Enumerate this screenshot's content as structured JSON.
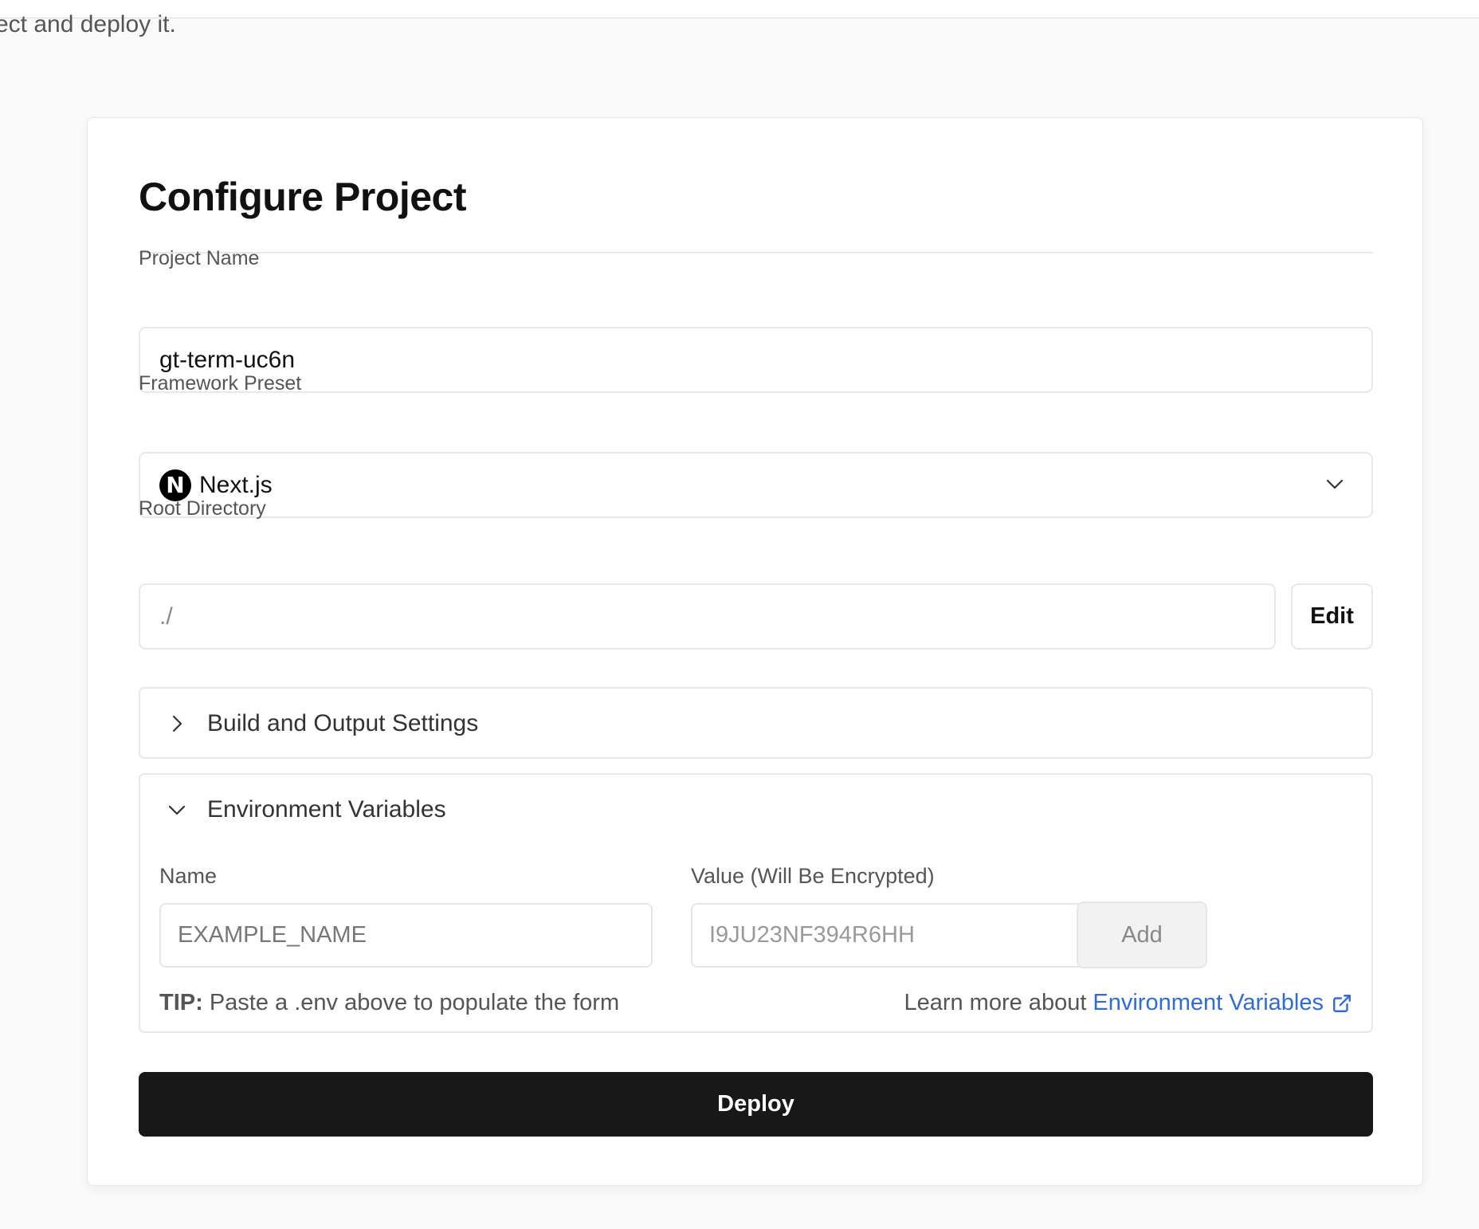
{
  "intro_text": "ect and deploy it.",
  "card": {
    "title": "Configure Project",
    "project_name": {
      "label": "Project Name",
      "value": "gt-term-uc6n"
    },
    "framework_preset": {
      "label": "Framework Preset",
      "value": "Next.js",
      "logo_letter": "N"
    },
    "root_directory": {
      "label": "Root Directory",
      "value": "./",
      "edit_label": "Edit"
    },
    "build_settings": {
      "label": "Build and Output Settings",
      "expanded": false
    },
    "env_vars": {
      "label": "Environment Variables",
      "expanded": true,
      "name_label": "Name",
      "name_placeholder": "EXAMPLE_NAME",
      "value_label": "Value (Will Be Encrypted)",
      "value_placeholder": "I9JU23NF394R6HH",
      "add_label": "Add",
      "tip_prefix": "TIP:",
      "tip_text": " Paste a .env above to populate the form",
      "learn_more_text": "Learn more about",
      "learn_more_link": "Environment Variables"
    },
    "deploy_label": "Deploy"
  },
  "colors": {
    "link": "#2f6bd9",
    "deploy_bg": "#181818",
    "border": "#e8e8e8"
  },
  "icons": [
    "next-logo-icon",
    "chevron-down-icon",
    "chevron-right-icon",
    "external-link-icon"
  ]
}
